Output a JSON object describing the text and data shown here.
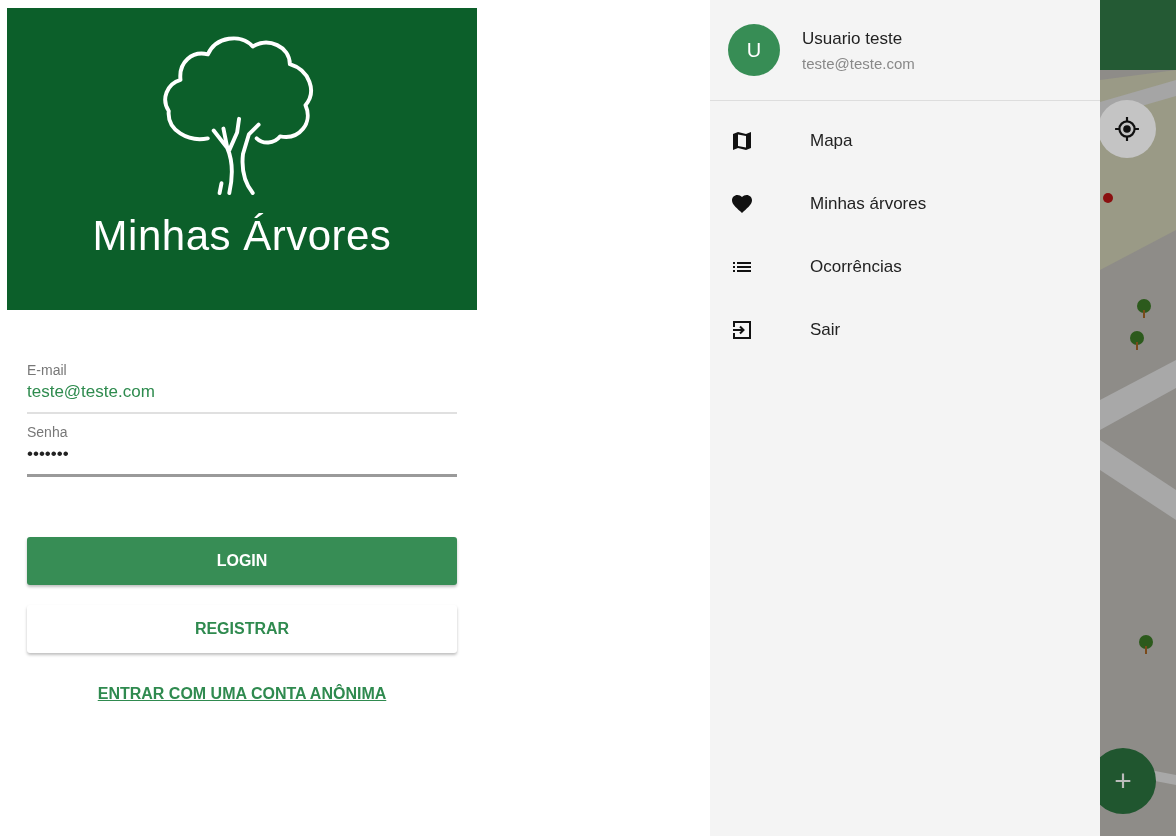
{
  "login": {
    "app_title": "Minhas Árvores",
    "fields": [
      {
        "label": "E-mail",
        "value": "teste@teste.com",
        "focused": false
      },
      {
        "label": "Senha",
        "value": "•••••••",
        "focused": true
      }
    ],
    "login_button": "LOGIN",
    "register_button": "REGISTRAR",
    "anonymous_link": "ENTRAR COM UMA CONTA ANÔNIMA"
  },
  "drawer": {
    "user": {
      "avatar": "U",
      "name": "Usuario teste",
      "email": "teste@teste.com"
    },
    "items": [
      {
        "label": "Mapa"
      },
      {
        "label": "Minhas árvores"
      },
      {
        "label": "Ocorrências"
      },
      {
        "label": "Sair"
      }
    ]
  },
  "map": {
    "fab": "+"
  }
}
